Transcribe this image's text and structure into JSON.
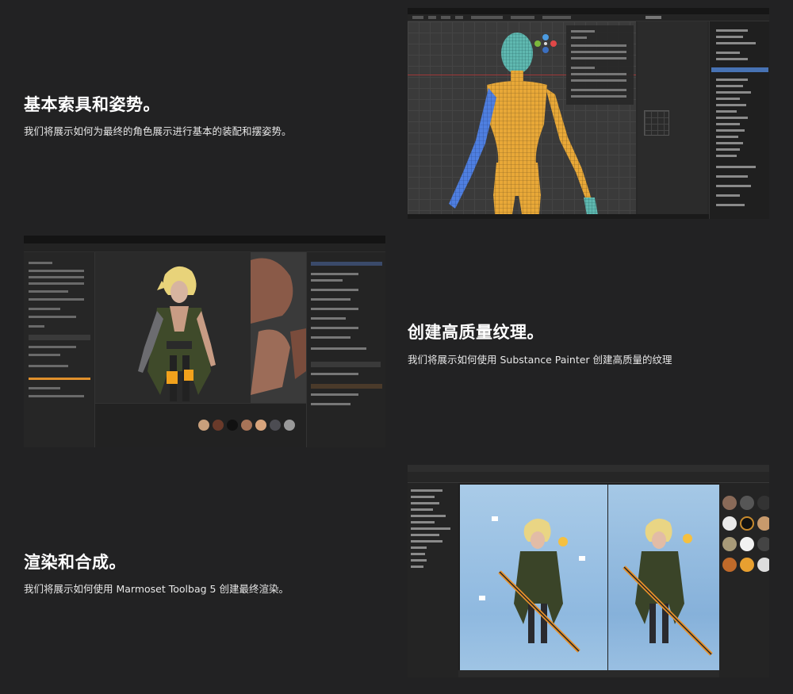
{
  "sections": [
    {
      "title": "基本索具和姿势。",
      "description": "我们将展示如何为最终的角色展示进行基本的装配和摆姿势。"
    },
    {
      "title": "创建高质量纹理。",
      "description": "我们将展示如何使用 Substance Painter 创建高质量的纹理"
    },
    {
      "title": "渲染和合成。",
      "description": "我们将展示如何使用 Marmoset Toolbag 5 创建最终渲染。"
    }
  ],
  "colors": {
    "background": "#222223",
    "selection_blue": "#4772b3",
    "accent_orange": "#e0902c",
    "mesh_yellow": "#e8a838",
    "render_sky": "#9fc4e4"
  },
  "icons": [
    "navigation-gizmo-icon",
    "texture-material-ball-icon",
    "light-bulb-icon"
  ]
}
